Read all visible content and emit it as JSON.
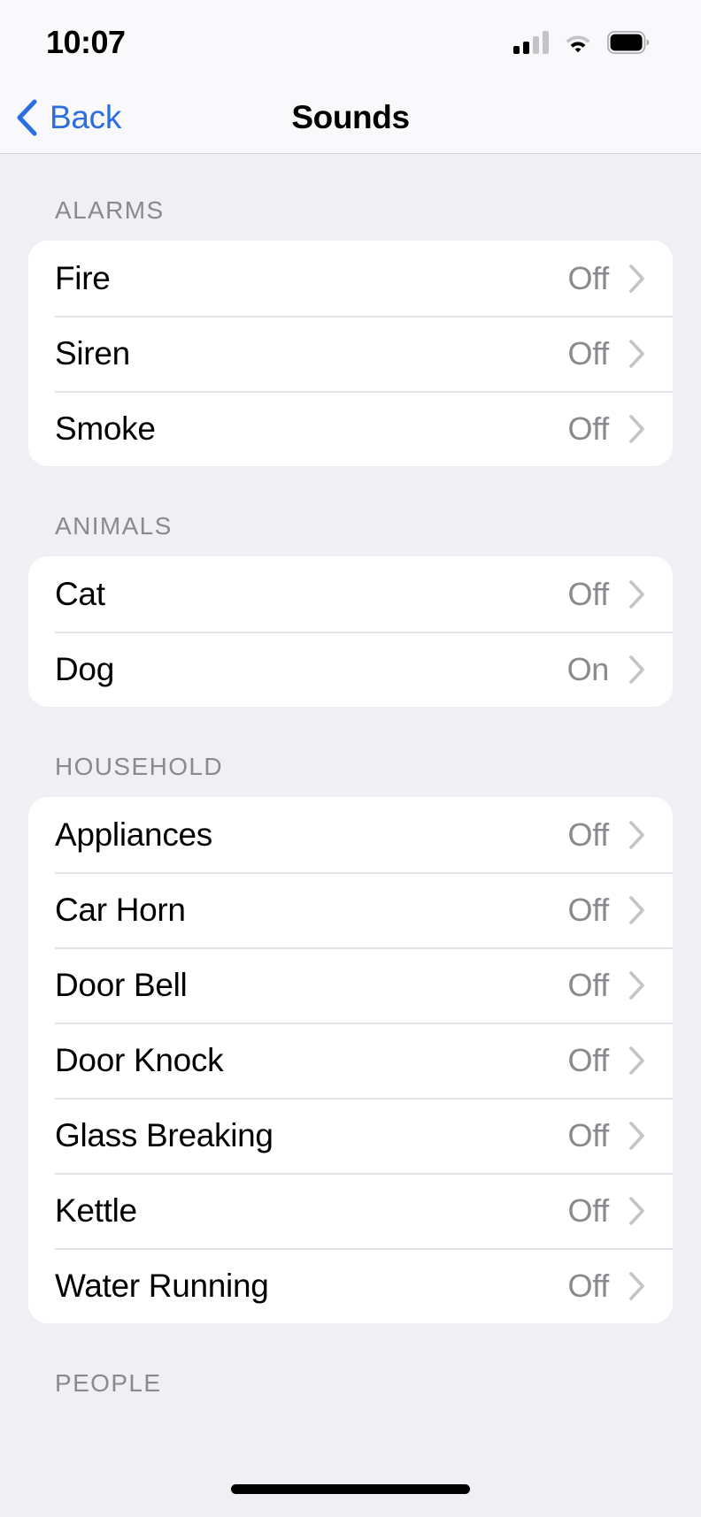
{
  "status_bar": {
    "time": "10:07",
    "cellular_icon": "cellular-signal-icon",
    "wifi_icon": "wifi-icon",
    "battery_icon": "battery-icon"
  },
  "nav_bar": {
    "back_label": "Back",
    "back_icon": "chevron-left-icon",
    "title": "Sounds"
  },
  "colors": {
    "accent_blue": "#2b6ee0",
    "background": "#f0eff4",
    "card": "#ffffff",
    "secondary_text": "#8a8a8e",
    "separator": "#e3e3e6"
  },
  "sections": [
    {
      "header": "ALARMS",
      "rows": [
        {
          "label": "Fire",
          "value": "Off"
        },
        {
          "label": "Siren",
          "value": "Off"
        },
        {
          "label": "Smoke",
          "value": "Off"
        }
      ]
    },
    {
      "header": "ANIMALS",
      "rows": [
        {
          "label": "Cat",
          "value": "Off"
        },
        {
          "label": "Dog",
          "value": "On"
        }
      ]
    },
    {
      "header": "HOUSEHOLD",
      "rows": [
        {
          "label": "Appliances",
          "value": "Off"
        },
        {
          "label": "Car Horn",
          "value": "Off"
        },
        {
          "label": "Door Bell",
          "value": "Off"
        },
        {
          "label": "Door Knock",
          "value": "Off"
        },
        {
          "label": "Glass Breaking",
          "value": "Off"
        },
        {
          "label": "Kettle",
          "value": "Off"
        },
        {
          "label": "Water Running",
          "value": "Off"
        }
      ]
    },
    {
      "header": "PEOPLE",
      "rows": []
    }
  ],
  "home_indicator": "home-indicator"
}
